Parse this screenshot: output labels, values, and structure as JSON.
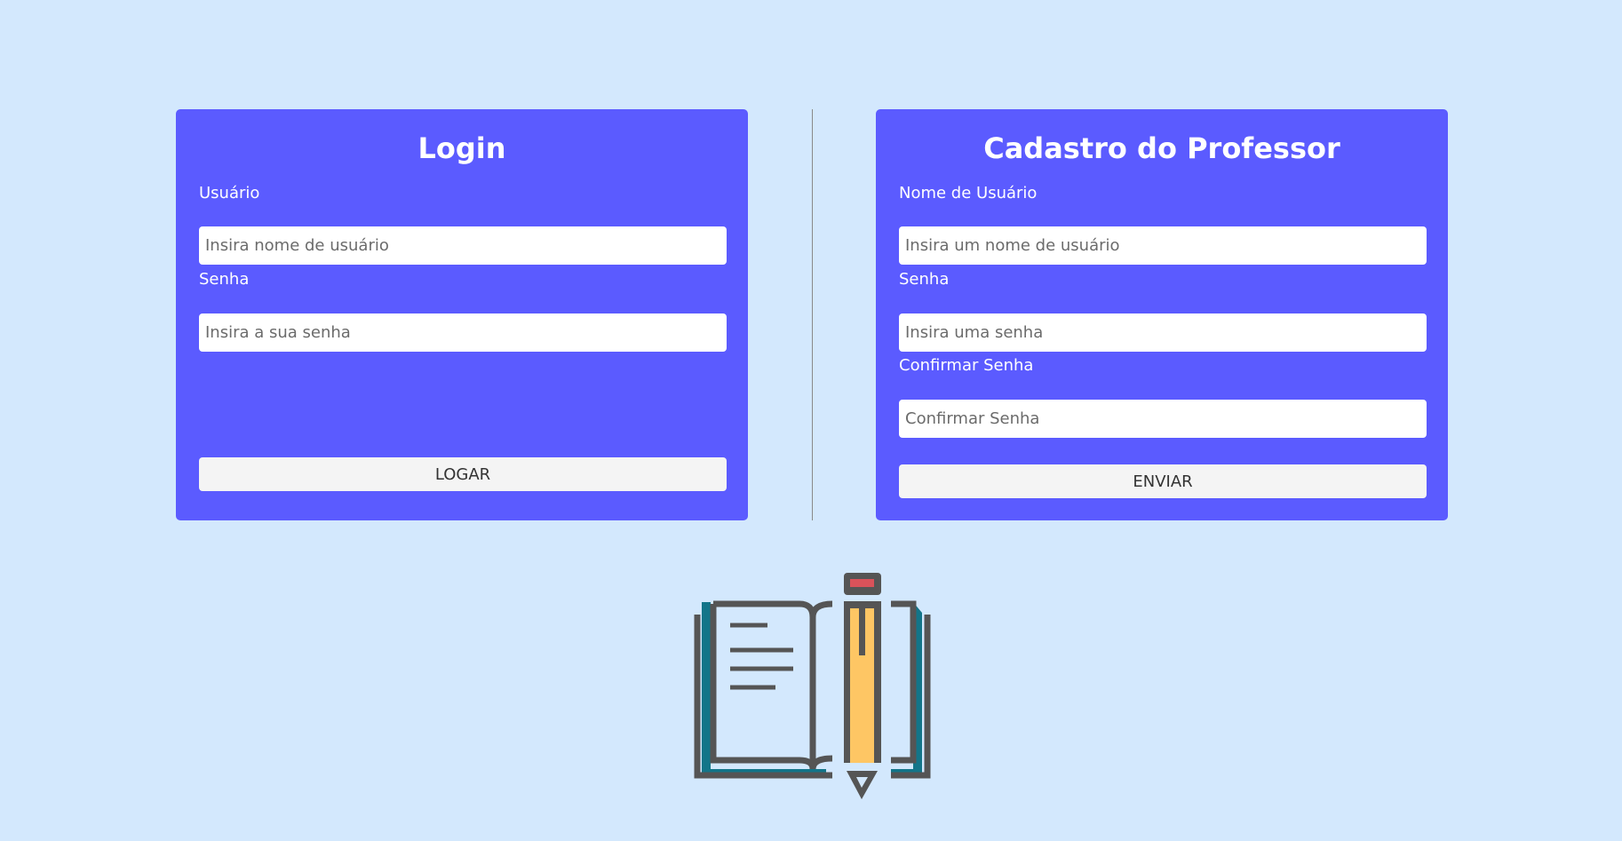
{
  "login": {
    "title": "Login",
    "username_label": "Usuário",
    "username_placeholder": "Insira nome de usuário",
    "password_label": "Senha",
    "password_placeholder": "Insira a sua senha",
    "submit_label": "LOGAR"
  },
  "signup": {
    "title": "Cadastro do Professor",
    "username_label": "Nome de Usuário",
    "username_placeholder": "Insira um nome de usuário",
    "password_label": "Senha",
    "password_placeholder": "Insira uma senha",
    "confirm_label": "Confirmar Senha",
    "confirm_placeholder": "Confirmar Senha",
    "submit_label": "ENVIAR"
  },
  "colors": {
    "background": "#d3e8fd",
    "card": "#5b5bff",
    "button": "#f4f4f4"
  },
  "logo": {
    "icon": "book-and-pencil-icon"
  }
}
